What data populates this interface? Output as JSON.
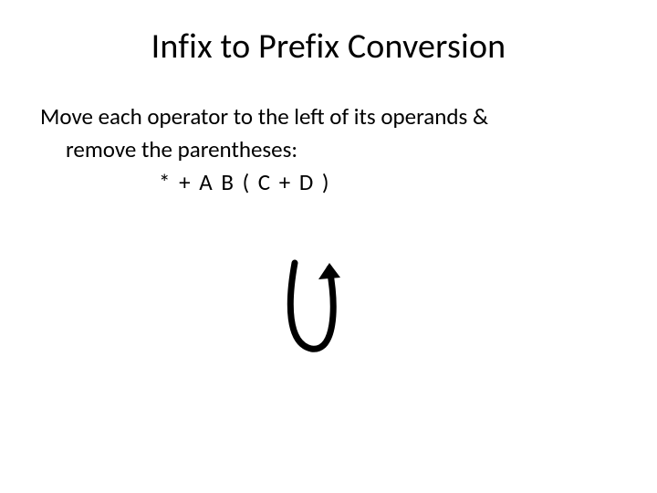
{
  "title": "Infix to Prefix Conversion",
  "instruction_line1": "Move each operator to the left of its operands &",
  "instruction_line2": "remove the parentheses:",
  "expression": "* + A  B  ( C + D )",
  "arrow_name": "curved-arrow"
}
